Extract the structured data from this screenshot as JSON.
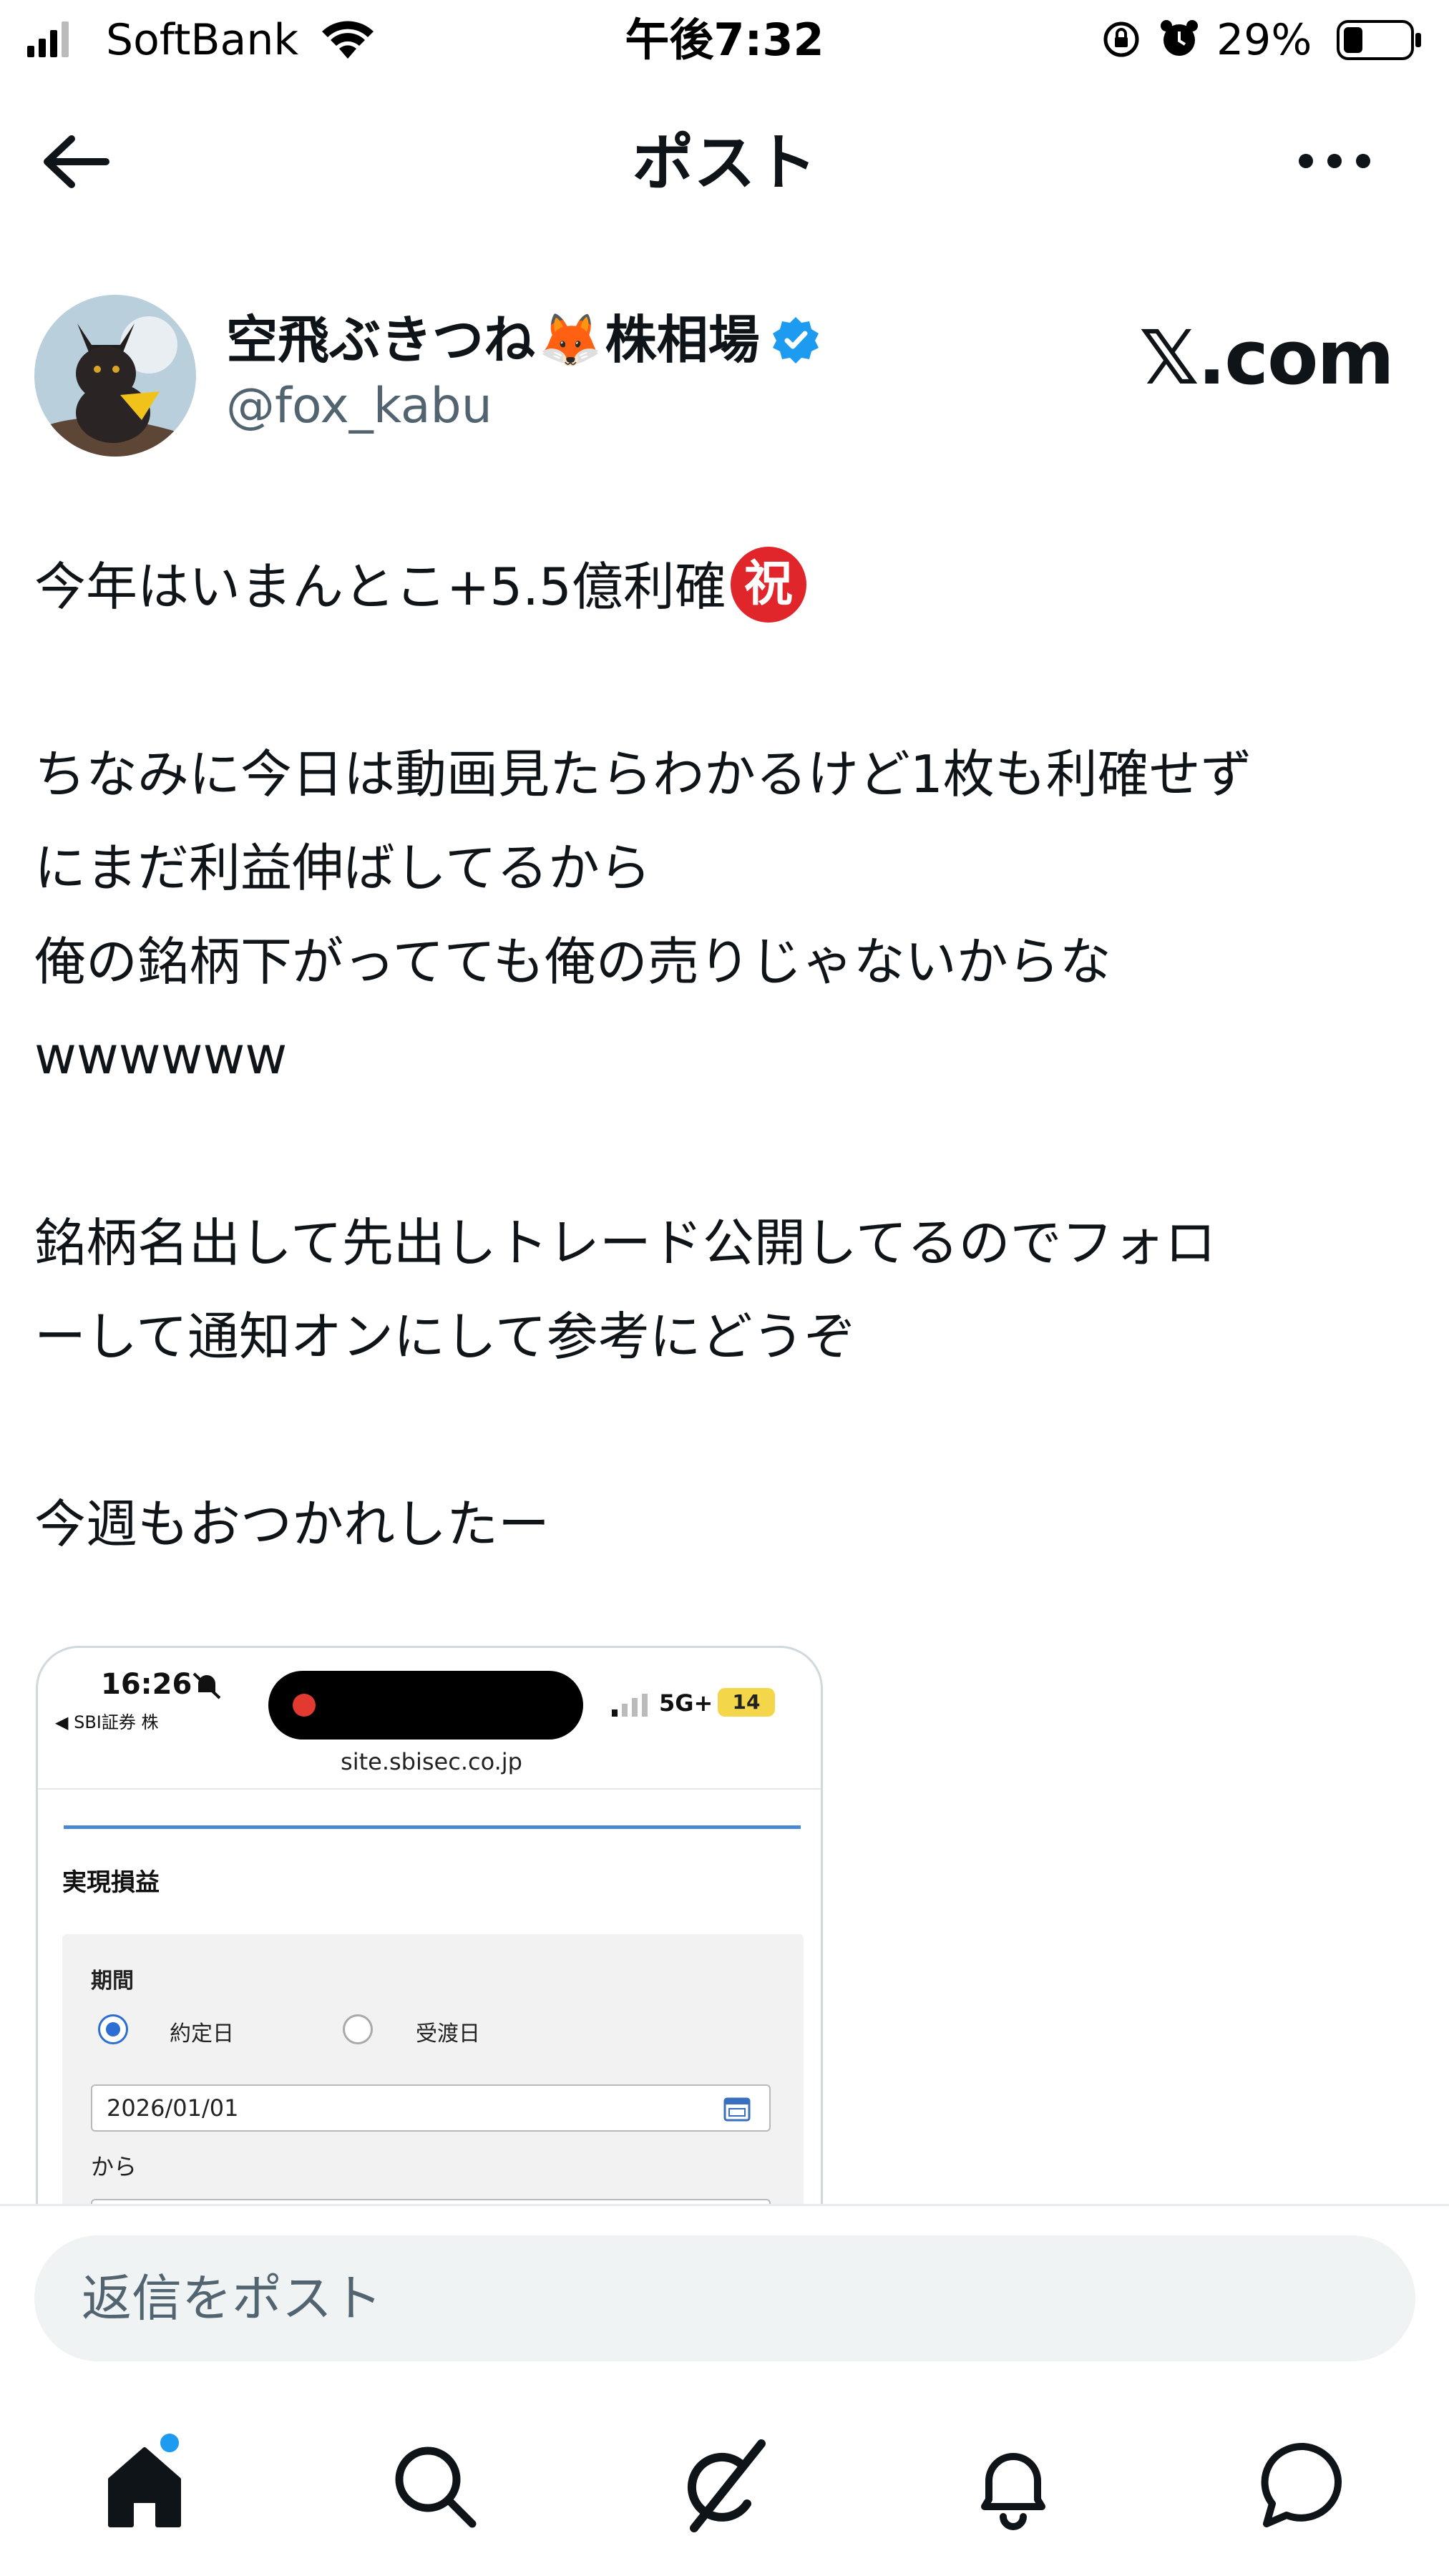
{
  "status_bar": {
    "carrier": "SoftBank",
    "time": "午後7:32",
    "battery_percent": "29%"
  },
  "nav": {
    "title": "ポスト"
  },
  "author": {
    "name_prefix": "空飛ぶきつね",
    "name_emoji": "🦊",
    "name_suffix": "株相場",
    "handle": "@fox_kabu",
    "verified": true,
    "watermark": "𝕏.com"
  },
  "post": {
    "line1": "今年はいまんとこ+5.5億利確",
    "line1_badge": "祝",
    "line2": "ちなみに今日は動画見たらわかるけど1枚も利確せず",
    "line3": "にまだ利益伸ばしてるから",
    "line4": "俺の銘柄下がってても俺の売りじゃないからな",
    "line5": "wwwwww",
    "line6": "銘柄名出して先出しトレード公開してるのでフォロ",
    "line7": "ーして通知オンにして参考にどうぞ",
    "line8": "今週もおつかれしたー"
  },
  "media": {
    "time": "16:26",
    "back_app": "◀ SBI証券 株",
    "network": "5G+",
    "battery": "14",
    "url": "site.sbisec.co.jp",
    "heading": "実現損益",
    "period_label": "期間",
    "radio_contract": "約定日",
    "radio_delivery": "受渡日",
    "date_from": "2026/01/01",
    "from_label": "から"
  },
  "reply": {
    "placeholder": "返信をポスト"
  },
  "tabs": {
    "home": "home-icon",
    "search": "search-icon",
    "grok": "grok-icon",
    "notifications": "bell-icon",
    "messages": "chat-icon",
    "accent": "#1d9bf0"
  }
}
